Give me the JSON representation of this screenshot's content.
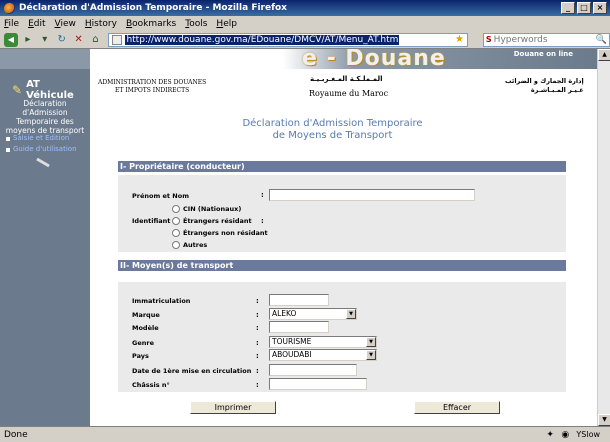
{
  "window": {
    "title": "Déclaration d'Admission Temporaire - Mozilla Firefox",
    "min": "_",
    "max": "□",
    "close": "×"
  },
  "menu": [
    {
      "label": "File",
      "key": "F",
      "rest": "ile"
    },
    {
      "label": "Edit",
      "key": "E",
      "rest": "dit"
    },
    {
      "label": "View",
      "key": "V",
      "rest": "iew"
    },
    {
      "label": "History",
      "key": "H",
      "rest": "istory"
    },
    {
      "label": "Bookmarks",
      "key": "B",
      "rest": "ookmarks"
    },
    {
      "label": "Tools",
      "key": "T",
      "rest": "ools"
    },
    {
      "label": "Help",
      "key": "H",
      "rest": "elp"
    }
  ],
  "nav": {
    "url": "http://www.douane.gov.ma/EDouane/DMCV/AT/Menu_AT.htm",
    "search_placeholder": "Hyperwords",
    "search_engine": "S"
  },
  "banner": {
    "logo": "e - Douane",
    "online": "Douane on line"
  },
  "header": {
    "left_line1": "ADMINISTRATION DES DOUANES",
    "left_line2": "ET IMPOTS INDIRECTS",
    "center_ar": "المـملـكـة المـغـربـيـة",
    "center": "Royaume du Maroc",
    "right_line1": "إدارة الجمارك و الضرائب",
    "right_line2": "غـيـر المـبـاشـرة"
  },
  "sidebar": {
    "title": "AT Véhicule",
    "desc": "Déclaration d'Admission Temporaire des moyens de transport",
    "links": [
      "Saisie et Edition",
      "Guide d'utilisation"
    ]
  },
  "page": {
    "title_line1": "Déclaration d'Admission Temporaire",
    "title_line2": "de Moyens de Transport"
  },
  "section1": {
    "title": "I- Propriétaire (conducteur)",
    "name_label": "Prénom et Nom",
    "id_label": "Identifiant",
    "radios": [
      "CIN (Nationaux)",
      "Étrangers résidant",
      "Étrangers non résidant",
      "Autres"
    ]
  },
  "section2": {
    "title": "II- Moyen(s) de transport",
    "fields": {
      "immat": "Immatriculation",
      "marque": "Marque",
      "modele": "Modèle",
      "genre": "Genre",
      "pays": "Pays",
      "date": "Date de 1ère mise en circulation",
      "chassis": "Châssis n°"
    },
    "marque_value": "ALEKO",
    "genre_value": "TOURISME",
    "pays_value": "ABOUDABI"
  },
  "buttons": {
    "print": "Imprimer",
    "clear": "Effacer"
  },
  "colon": ":",
  "status": {
    "text": "Done",
    "yslow": "YSlow"
  }
}
